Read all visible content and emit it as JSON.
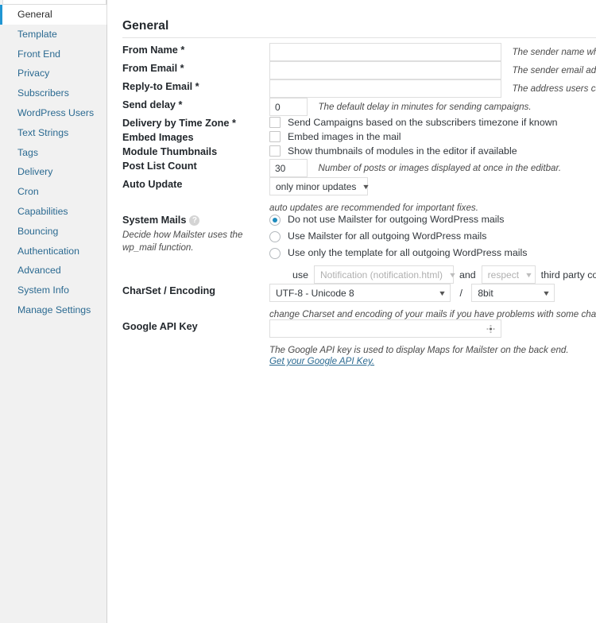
{
  "sidebar": {
    "items": [
      {
        "label": "General",
        "active": true
      },
      {
        "label": "Template",
        "active": false
      },
      {
        "label": "Front End",
        "active": false
      },
      {
        "label": "Privacy",
        "active": false
      },
      {
        "label": "Subscribers",
        "active": false
      },
      {
        "label": "WordPress Users",
        "active": false
      },
      {
        "label": "Text Strings",
        "active": false
      },
      {
        "label": "Tags",
        "active": false
      },
      {
        "label": "Delivery",
        "active": false
      },
      {
        "label": "Cron",
        "active": false
      },
      {
        "label": "Capabilities",
        "active": false
      },
      {
        "label": "Bouncing",
        "active": false
      },
      {
        "label": "Authentication",
        "active": false
      },
      {
        "label": "Advanced",
        "active": false
      },
      {
        "label": "System Info",
        "active": false
      },
      {
        "label": "Manage Settings",
        "active": false
      }
    ]
  },
  "main": {
    "title": "General",
    "fields": {
      "from_name": {
        "label": "From Name *",
        "value": "",
        "description": "The sender name which"
      },
      "from_email": {
        "label": "From Email *",
        "value": "",
        "description": "The sender email addres"
      },
      "reply_to_email": {
        "label": "Reply-to Email *",
        "value": "",
        "description": "The address users can re"
      },
      "send_delay": {
        "label": "Send delay *",
        "value": "0",
        "description": "The default delay in minutes for sending campaigns."
      },
      "delivery_time_zone": {
        "label": "Delivery by Time Zone *",
        "checkbox_label": "Send Campaigns based on the subscribers timezone if known",
        "checked": false
      },
      "embed_images": {
        "label": "Embed Images",
        "checkbox_label": "Embed images in the mail",
        "checked": false
      },
      "module_thumbnails": {
        "label": "Module Thumbnails",
        "checkbox_label": "Show thumbnails of modules in the editor if available",
        "checked": false
      },
      "post_list_count": {
        "label": "Post List Count",
        "value": "30",
        "description": "Number of posts or images displayed at once in the editbar."
      },
      "auto_update": {
        "label": "Auto Update",
        "selected": "only minor updates",
        "options": [
          "only minor updates"
        ],
        "description": "auto updates are recommended for important fixes."
      },
      "system_mails": {
        "label": "System Mails",
        "help_icon": "question-mark-icon",
        "label_description": "Decide how Mailster uses the wp_mail function.",
        "options": [
          {
            "label": "Do not use Mailster for outgoing WordPress mails",
            "checked": true
          },
          {
            "label": "Use Mailster for all outgoing WordPress mails",
            "checked": false
          },
          {
            "label": "Use only the template for all outgoing WordPress mails",
            "checked": false
          }
        ],
        "nested": {
          "prefix_word": "use",
          "template_selected": "Notification (notification.html)",
          "middle_word": "and",
          "respect_selected": "respect",
          "suffix_word": "third party content ty"
        }
      },
      "charset_encoding": {
        "label": "CharSet / Encoding",
        "charset_selected": "UTF-8 - Unicode 8",
        "separator": "/",
        "encoding_selected": "8bit",
        "description": "change Charset and encoding of your mails if you have problems with some chara"
      },
      "google_api_key": {
        "label": "Google API Key",
        "value": "",
        "icon": "spinner-icon",
        "description": "The Google API key is used to display Maps for Mailster on the back end.",
        "link_text": "Get your Google API Key."
      }
    }
  },
  "colors": {
    "accent": "#2196d3",
    "link": "#2b6a91",
    "radio_fill": "#1e8cbe",
    "sidebar_bg": "#f1f1f1",
    "text": "#23282d"
  }
}
